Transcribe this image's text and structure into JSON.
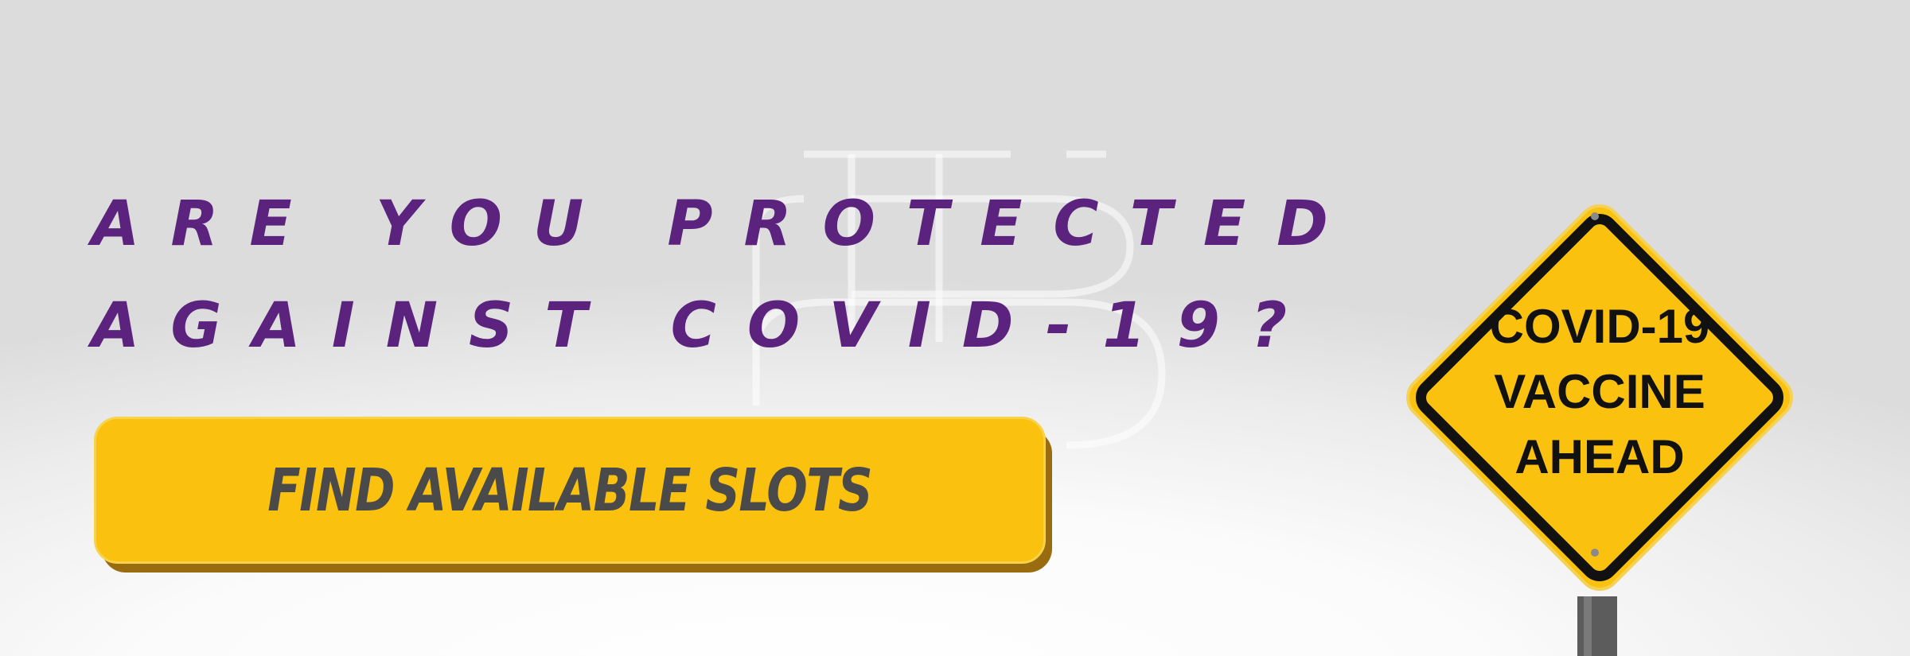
{
  "headline": {
    "line1": "ARE YOU PROTECTED",
    "line2": "AGAINST COVID-19?"
  },
  "cta": {
    "label": "FIND AVAILABLE SLOTS"
  },
  "sign": {
    "line1": "COVID-19",
    "line2": "VACCINE",
    "line3": "AHEAD"
  },
  "colors": {
    "headline": "#5b237e",
    "cta_background": "#fbc10f",
    "cta_text": "#4a4a4a",
    "sign_yellow": "#fbc10f",
    "sign_border": "#111111"
  }
}
